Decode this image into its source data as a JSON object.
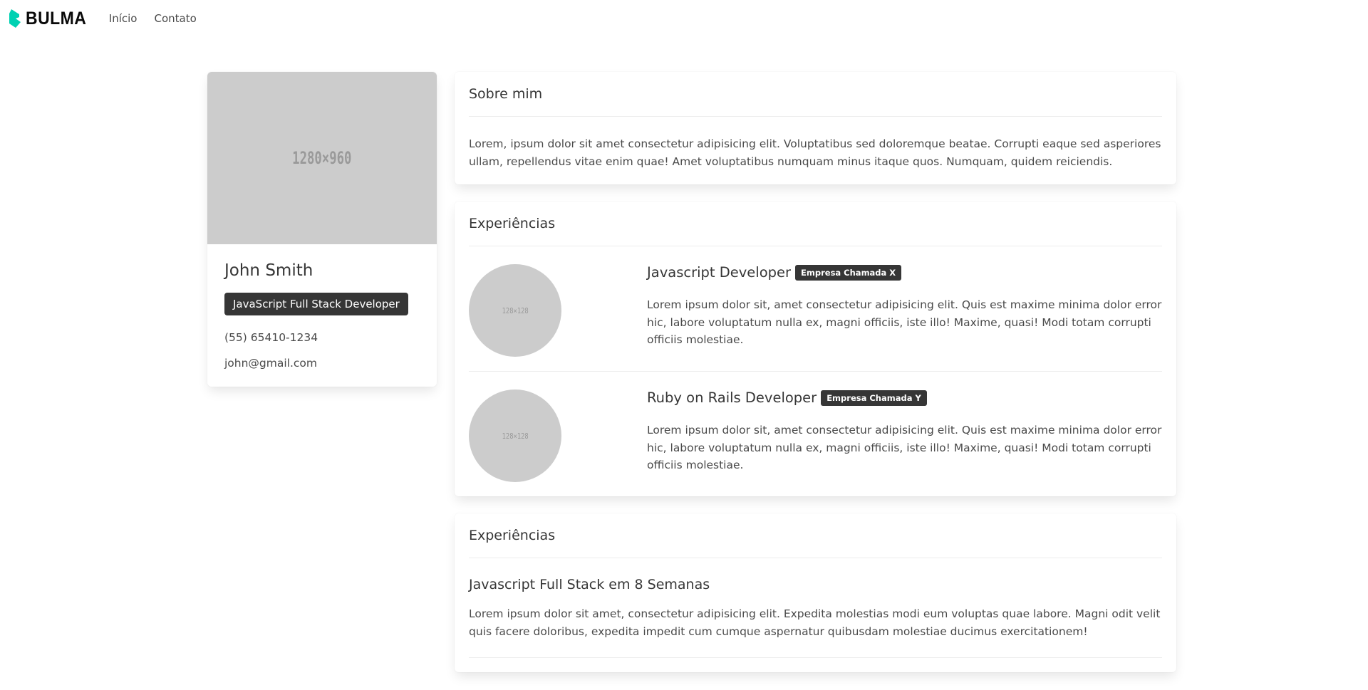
{
  "navbar": {
    "brand": "BULMA",
    "links": [
      "Início",
      "Contato"
    ]
  },
  "profile": {
    "image_placeholder": "1280×960",
    "name": "John Smith",
    "role": "JavaScript Full Stack Developer",
    "phone": "(55) 65410-1234",
    "email": "john@gmail.com"
  },
  "about": {
    "title": "Sobre mim",
    "text": "Lorem, ipsum dolor sit amet consectetur adipisicing elit. Voluptatibus sed doloremque beatae. Corrupti eaque sed asperiores ullam, repellendus vitae enim quae! Amet voluptatibus numquam minus itaque quos. Numquam, quidem reiciendis."
  },
  "experience": {
    "title": "Experiências",
    "items": [
      {
        "avatar_placeholder": "128×128",
        "title": "Javascript Developer",
        "company": "Empresa Chamada X",
        "text": "Lorem ipsum dolor sit, amet consectetur adipisicing elit. Quis est maxime minima dolor error hic, labore voluptatum nulla ex, magni officiis, iste illo! Maxime, quasi! Modi totam corrupti officiis molestiae."
      },
      {
        "avatar_placeholder": "128×128",
        "title": "Ruby on Rails Developer",
        "company": "Empresa Chamada Y",
        "text": "Lorem ipsum dolor sit, amet consectetur adipisicing elit. Quis est maxime minima dolor error hic, labore voluptatum nulla ex, magni officiis, iste illo! Maxime, quasi! Modi totam corrupti officiis molestiae."
      }
    ]
  },
  "education": {
    "title": "Experiências",
    "items": [
      {
        "title": "Javascript Full Stack em 8 Semanas",
        "text": "Lorem ipsum dolor sit amet, consectetur adipisicing elit. Expedita molestias modi eum voluptas quae labore. Magni odit velit quis facere doloribus, expedita impedit cum cumque aspernatur quibusdam molestiae ducimus exercitationem!"
      }
    ]
  },
  "colors": {
    "brand_accent": "#00d1b2",
    "tag_dark": "#363636",
    "placeholder_gray": "#cccccc"
  },
  "icons": {
    "brand_logo": "bulma-logo-icon"
  }
}
